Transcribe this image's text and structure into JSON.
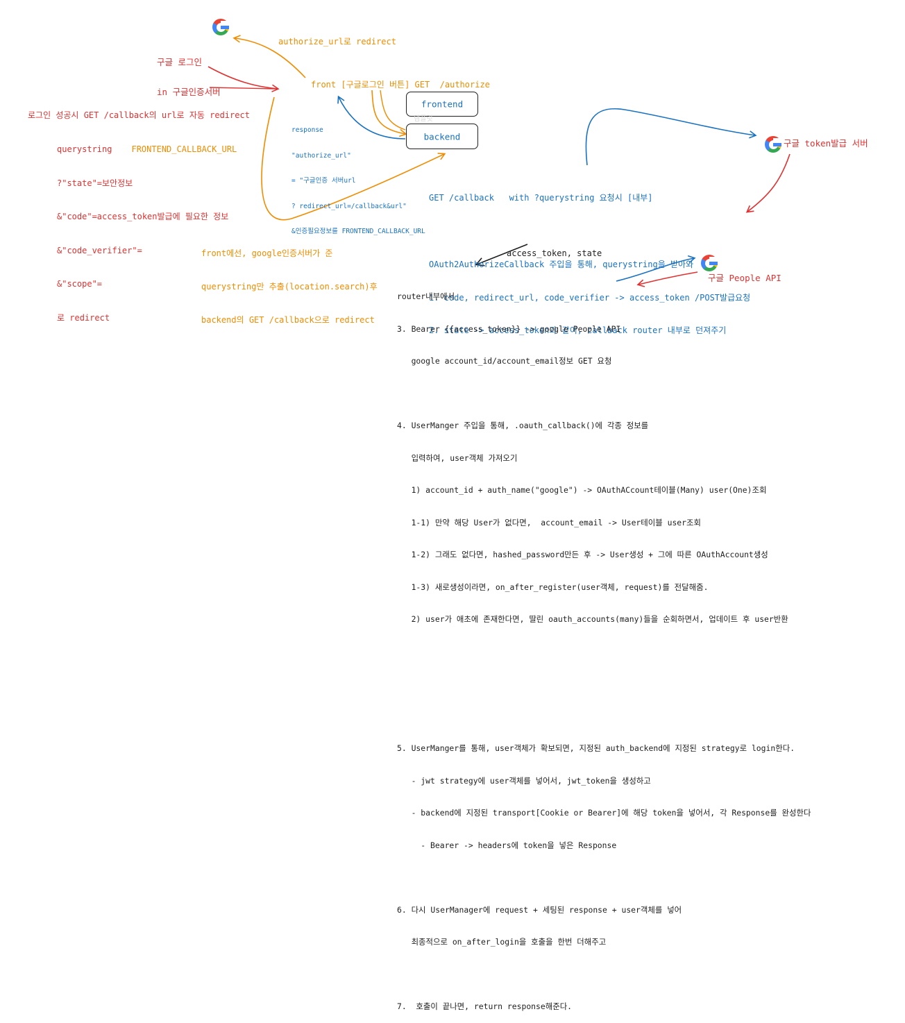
{
  "nodes": {
    "google_login": {
      "line1": "구글 로그인",
      "line2": "in 구글인증서버"
    },
    "authorize_redirect": "authorize_url로 redirect",
    "front_button": "front [구글로그인 버튼] GET  /authorize",
    "frontend_box": "frontend",
    "backend_box": "backend",
    "watermark": "템플릿",
    "google_token_server": "구글 token발급 서버",
    "google_people_api": "구글 People API"
  },
  "login_success": {
    "line1": "로그인 성공시 GET /callback의 url로 자동 redirect",
    "line2_a": "querystring",
    "line2_b": "FRONTEND_CALLBACK_URL",
    "line3": "?\"state\"=보안정보",
    "line4": "&\"code\"=access_token발급에 필요한 정보",
    "line5": "&\"code_verifier\"=",
    "line6": "&\"scope\"=",
    "line7": "로 redirect"
  },
  "response_note": {
    "line1": "response",
    "line2": "\"authorize_url\"",
    "line3": "= \"구글인증 서버url",
    "line4": "? redirect_url=/callback&url\"",
    "line5": "&인증필요정보를 FRONTEND_CALLBACK_URL"
  },
  "front_callback_note": {
    "line1": "front에선, google인증서버가 준",
    "line2": "querystring만 추출(location.search)후",
    "line3": "backend의 GET /callback으로 redirect"
  },
  "callback_block": {
    "line1": "GET /callback   with ?querystring 요청시 [내부]",
    "line2": "OAuth2AuthorizeCallback 주입을 통해, querystring을 받아와",
    "line3": "1. code, redirect_url, code_verifier -> access_token /POST발급요청",
    "line4": "2. state -> access_token과 같이, callback router 내부로 던져주기"
  },
  "access_token_arrow_label": "access_token, state",
  "steps": [
    "router내부에서",
    "3. Bearer {{access_token}} -> google People API",
    "   google account_id/account_email정보 GET 요청",
    "",
    "4. UserManger 주입을 통해, .oauth_callback()에 각종 정보를",
    "   입력하여, user객체 가져오기",
    "   1) account_id + auth_name(\"google\") -> OAuthACcount테이블(Many) user(One)조회",
    "   1-1) 만약 해당 User가 없다면,  account_email -> User테이블 user조회",
    "   1-2) 그래도 없다면, hashed_password만든 후 -> User생성 + 그에 따른 OAuthAccount생성",
    "   1-3) 새로생성이라면, on_after_register(user객체, request)를 전달해줌.",
    "   2) user가 애초에 존재한다면, 딸린 oauth_accounts(many)들을 순회하면서, 업데이트 후 user반환",
    "",
    "",
    "",
    "5. UserManger를 통해, user객체가 확보되면, 지정된 auth_backend에 지정된 strategy로 login한다.",
    "   - jwt strategy에 user객체를 넣어서, jwt_token을 생성하고",
    "   - backend에 지정된 transport[Cookie or Bearer]에 해당 token을 넣어서, 각 Response를 완성한다",
    "     - Bearer -> headers에 token을 넣은 Response",
    "",
    "6. 다시 UserManager에 request + 세팅된 response + user객체를 넣어",
    "   최종적으로 on_after_login을 호출을 한번 더해주고",
    "",
    "7.  호출이 끝나면, return response해준다."
  ],
  "colors": {
    "red": "#e03131",
    "orange": "#f08c00",
    "blue": "#1971c2",
    "ink": "#1e1e1e"
  },
  "icons": [
    "google-logo-icon",
    "google-logo-icon",
    "google-logo-icon"
  ]
}
